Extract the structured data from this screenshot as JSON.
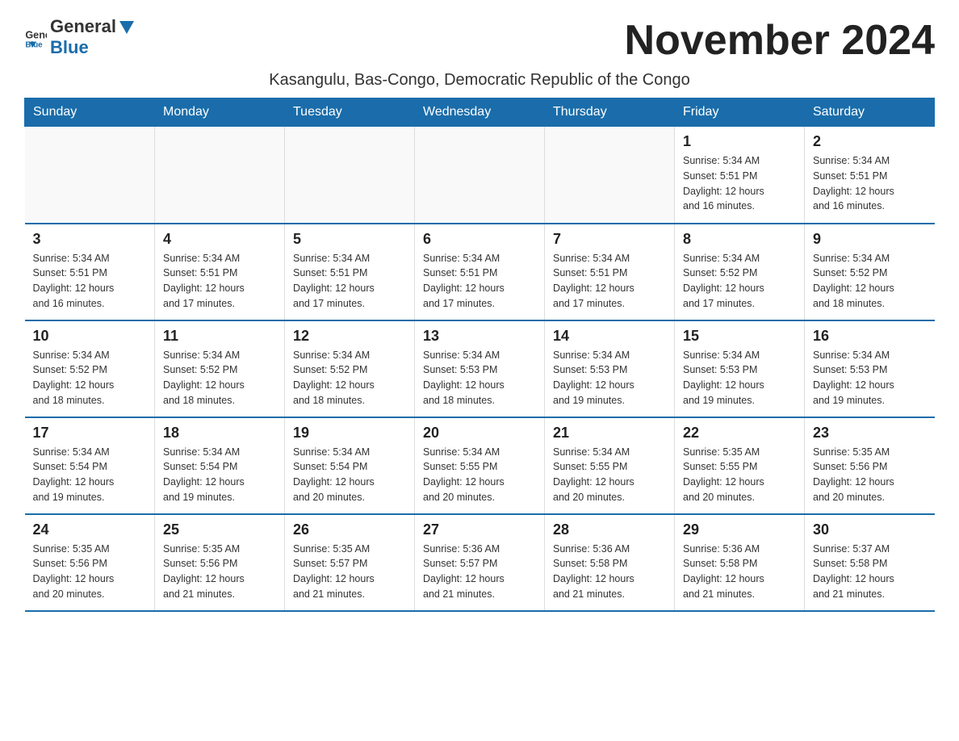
{
  "header": {
    "logo_general": "General",
    "logo_blue": "Blue",
    "month_title": "November 2024",
    "location": "Kasangulu, Bas-Congo, Democratic Republic of the Congo"
  },
  "weekdays": [
    "Sunday",
    "Monday",
    "Tuesday",
    "Wednesday",
    "Thursday",
    "Friday",
    "Saturday"
  ],
  "weeks": [
    [
      {
        "day": "",
        "info": ""
      },
      {
        "day": "",
        "info": ""
      },
      {
        "day": "",
        "info": ""
      },
      {
        "day": "",
        "info": ""
      },
      {
        "day": "",
        "info": ""
      },
      {
        "day": "1",
        "info": "Sunrise: 5:34 AM\nSunset: 5:51 PM\nDaylight: 12 hours\nand 16 minutes."
      },
      {
        "day": "2",
        "info": "Sunrise: 5:34 AM\nSunset: 5:51 PM\nDaylight: 12 hours\nand 16 minutes."
      }
    ],
    [
      {
        "day": "3",
        "info": "Sunrise: 5:34 AM\nSunset: 5:51 PM\nDaylight: 12 hours\nand 16 minutes."
      },
      {
        "day": "4",
        "info": "Sunrise: 5:34 AM\nSunset: 5:51 PM\nDaylight: 12 hours\nand 17 minutes."
      },
      {
        "day": "5",
        "info": "Sunrise: 5:34 AM\nSunset: 5:51 PM\nDaylight: 12 hours\nand 17 minutes."
      },
      {
        "day": "6",
        "info": "Sunrise: 5:34 AM\nSunset: 5:51 PM\nDaylight: 12 hours\nand 17 minutes."
      },
      {
        "day": "7",
        "info": "Sunrise: 5:34 AM\nSunset: 5:51 PM\nDaylight: 12 hours\nand 17 minutes."
      },
      {
        "day": "8",
        "info": "Sunrise: 5:34 AM\nSunset: 5:52 PM\nDaylight: 12 hours\nand 17 minutes."
      },
      {
        "day": "9",
        "info": "Sunrise: 5:34 AM\nSunset: 5:52 PM\nDaylight: 12 hours\nand 18 minutes."
      }
    ],
    [
      {
        "day": "10",
        "info": "Sunrise: 5:34 AM\nSunset: 5:52 PM\nDaylight: 12 hours\nand 18 minutes."
      },
      {
        "day": "11",
        "info": "Sunrise: 5:34 AM\nSunset: 5:52 PM\nDaylight: 12 hours\nand 18 minutes."
      },
      {
        "day": "12",
        "info": "Sunrise: 5:34 AM\nSunset: 5:52 PM\nDaylight: 12 hours\nand 18 minutes."
      },
      {
        "day": "13",
        "info": "Sunrise: 5:34 AM\nSunset: 5:53 PM\nDaylight: 12 hours\nand 18 minutes."
      },
      {
        "day": "14",
        "info": "Sunrise: 5:34 AM\nSunset: 5:53 PM\nDaylight: 12 hours\nand 19 minutes."
      },
      {
        "day": "15",
        "info": "Sunrise: 5:34 AM\nSunset: 5:53 PM\nDaylight: 12 hours\nand 19 minutes."
      },
      {
        "day": "16",
        "info": "Sunrise: 5:34 AM\nSunset: 5:53 PM\nDaylight: 12 hours\nand 19 minutes."
      }
    ],
    [
      {
        "day": "17",
        "info": "Sunrise: 5:34 AM\nSunset: 5:54 PM\nDaylight: 12 hours\nand 19 minutes."
      },
      {
        "day": "18",
        "info": "Sunrise: 5:34 AM\nSunset: 5:54 PM\nDaylight: 12 hours\nand 19 minutes."
      },
      {
        "day": "19",
        "info": "Sunrise: 5:34 AM\nSunset: 5:54 PM\nDaylight: 12 hours\nand 20 minutes."
      },
      {
        "day": "20",
        "info": "Sunrise: 5:34 AM\nSunset: 5:55 PM\nDaylight: 12 hours\nand 20 minutes."
      },
      {
        "day": "21",
        "info": "Sunrise: 5:34 AM\nSunset: 5:55 PM\nDaylight: 12 hours\nand 20 minutes."
      },
      {
        "day": "22",
        "info": "Sunrise: 5:35 AM\nSunset: 5:55 PM\nDaylight: 12 hours\nand 20 minutes."
      },
      {
        "day": "23",
        "info": "Sunrise: 5:35 AM\nSunset: 5:56 PM\nDaylight: 12 hours\nand 20 minutes."
      }
    ],
    [
      {
        "day": "24",
        "info": "Sunrise: 5:35 AM\nSunset: 5:56 PM\nDaylight: 12 hours\nand 20 minutes."
      },
      {
        "day": "25",
        "info": "Sunrise: 5:35 AM\nSunset: 5:56 PM\nDaylight: 12 hours\nand 21 minutes."
      },
      {
        "day": "26",
        "info": "Sunrise: 5:35 AM\nSunset: 5:57 PM\nDaylight: 12 hours\nand 21 minutes."
      },
      {
        "day": "27",
        "info": "Sunrise: 5:36 AM\nSunset: 5:57 PM\nDaylight: 12 hours\nand 21 minutes."
      },
      {
        "day": "28",
        "info": "Sunrise: 5:36 AM\nSunset: 5:58 PM\nDaylight: 12 hours\nand 21 minutes."
      },
      {
        "day": "29",
        "info": "Sunrise: 5:36 AM\nSunset: 5:58 PM\nDaylight: 12 hours\nand 21 minutes."
      },
      {
        "day": "30",
        "info": "Sunrise: 5:37 AM\nSunset: 5:58 PM\nDaylight: 12 hours\nand 21 minutes."
      }
    ]
  ]
}
